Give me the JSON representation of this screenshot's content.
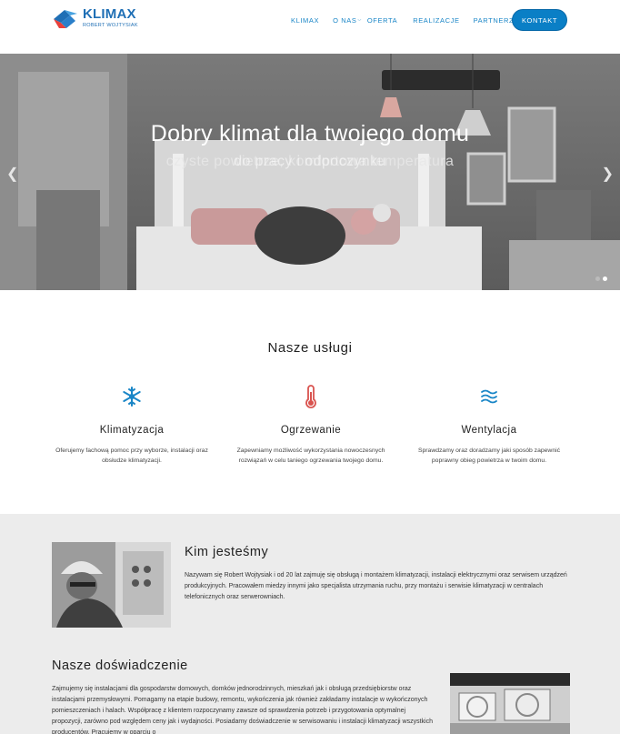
{
  "header": {
    "logo": {
      "brand": "KLIMAX",
      "sub": "ROBERT WOJTYSIAK"
    },
    "nav": [
      "KLIMAX",
      "O NAS",
      "OFERTA",
      "REALIZACJE",
      "PARTNERZY"
    ],
    "contact_label": "KONTAKT"
  },
  "hero": {
    "title": "Dobry klimat dla twojego domu",
    "subtitle": "czyste powietrze, komfortowa temperatura",
    "subtitle_overlay": "do pracy i odpoczynku",
    "slides": 2,
    "active_slide": 2
  },
  "services": {
    "title": "Nasze usługi",
    "items": [
      {
        "icon": "snowflake-icon",
        "name": "Klimatyzacja",
        "desc": "Oferujemy fachową pomoc przy wyborze, instalacji oraz obsłudze klimatyzacji."
      },
      {
        "icon": "thermometer-icon",
        "name": "Ogrzewanie",
        "desc": "Zapewniamy możliwość wykorzystania nowoczesnych rozwiązań w celu taniego ogrzewania twojego domu."
      },
      {
        "icon": "waves-icon",
        "name": "Wentylacja",
        "desc": "Sprawdzamy oraz doradzamy jaki sposób zapewnić poprawny obieg powietrza w twoim domu."
      }
    ]
  },
  "about": {
    "title": "Kim jesteśmy",
    "text": "Nazywam się Robert Wojtysiak i od 20 lat zajmuję się obsługą i montażem klimatyzacji, instalacji elektrycznymi oraz serwisem urządzeń produkcyjnych. Pracowałem miedzy innymi jako specjalista utrzymania ruchu, przy montażu i serwisie klimatyzacji w centralach telefonicznych oraz serwerowniach."
  },
  "experience": {
    "title": "Nasze doświadczenie",
    "text": "Zajmujemy się instalacjami dla gospodarstw domowych, domków jednorodzinnych, mieszkań jak i obsługą przedsiębiorstw oraz instalacjami przemysłowymi. Pomagamy na etapie budowy, remontu, wykończenia jak również zakładamy instalacje w wykończonych pomieszczeniach i halach. Współpracę z klientem rozpoczynamy zawsze od sprawdzenia potrzeb i przygotowania optymalnej propozycji, zarówno pod względem ceny jak i wydajności. Posiadamy doświadczenie w serwisowaniu i instalacji klimatyzacji wszystkich producentów. Pracujemy w oparciu o"
  },
  "colors": {
    "accent": "#0a7fc6",
    "nav": "#1a86c7",
    "icon_blue": "#1a86c7",
    "icon_red": "#d9534f",
    "grey_bg": "#ececec"
  }
}
